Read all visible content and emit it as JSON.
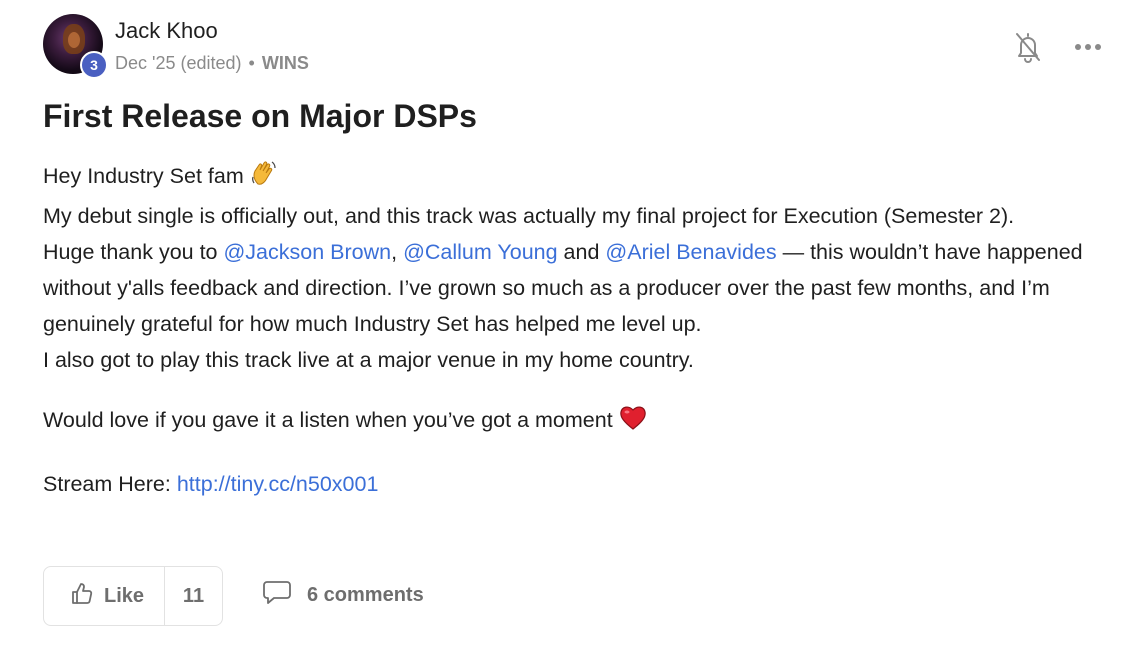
{
  "post": {
    "author": "Jack Khoo",
    "level": "3",
    "date": "Dec '25 (edited)",
    "separator": "•",
    "category": "WINS",
    "title": "First Release on Major DSPs",
    "line1": "Hey Industry Set fam ",
    "line2": "My debut single is officially out, and this track was actually my final project for Execution (Semester 2).",
    "line3_a": "Huge thank you to ",
    "mention1": "@Jackson Brown",
    "line3_b": ", ",
    "mention2": "@Callum Young",
    "line3_c": " and ",
    "mention3": "@Ariel Benavides",
    "line3_d": " — this wouldn’t have happened without y'alls feedback and direction. I’ve grown so much as a producer over the past few months, and I’m genuinely grateful for how much Industry Set has helped me level up.",
    "line4": "I also got to play this track live at a major venue in my home country.",
    "line5": "Would love if you gave it a listen when you’ve got a moment ",
    "stream_label": "Stream Here: ",
    "stream_link": "http://tiny.cc/n50x001"
  },
  "icons": {
    "bell": "bell-off-icon",
    "more": "more-horizontal-icon",
    "wave": "waving-hand-emoji",
    "heart": "red-heart-emoji",
    "like": "thumbs-up-icon",
    "comment": "comment-bubble-icon"
  },
  "colors": {
    "accent_link": "#3b6fd8",
    "level_badge": "#4a5fc1",
    "muted_text": "#8a8a8a"
  },
  "actions": {
    "like_label": "Like",
    "like_count": "11",
    "comments_label": "6 comments"
  }
}
